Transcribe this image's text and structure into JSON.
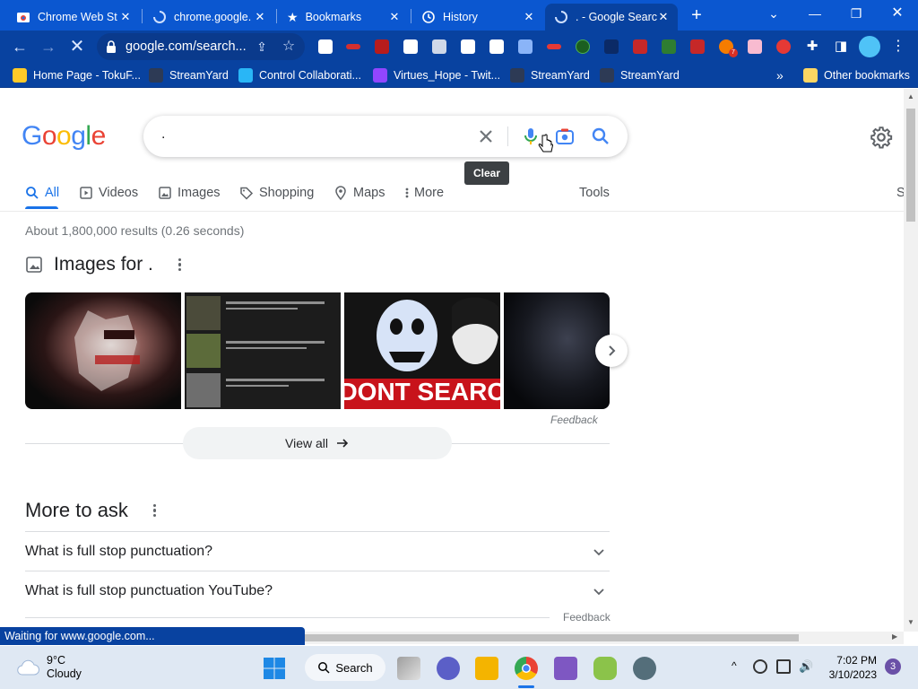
{
  "browser": {
    "tabs": [
      {
        "title": "Chrome Web St",
        "icon": "chrome-web-store-icon"
      },
      {
        "title": "chrome.google.",
        "icon": "loading-spinner-icon"
      },
      {
        "title": "Bookmarks",
        "icon": "star-icon"
      },
      {
        "title": "History",
        "icon": "history-icon"
      },
      {
        "title": ". - Google Searc",
        "icon": "loading-spinner-icon",
        "active": true
      }
    ],
    "omnibox_url": "google.com/search...",
    "status_text": "Waiting for www.google.com..."
  },
  "bookmarks": {
    "items": [
      {
        "label": "Home Page - TokuF..."
      },
      {
        "label": "StreamYard"
      },
      {
        "label": "Control Collaborati..."
      },
      {
        "label": "Virtues_Hope - Twit..."
      },
      {
        "label": "StreamYard"
      },
      {
        "label": "StreamYard"
      }
    ],
    "overflow": "»",
    "other": "Other bookmarks"
  },
  "google": {
    "logo": [
      "G",
      "o",
      "o",
      "g",
      "l",
      "e"
    ],
    "logo_colors": [
      "#4285F4",
      "#EA4335",
      "#FBBC05",
      "#4285F4",
      "#34A853",
      "#EA4335"
    ],
    "query": ".",
    "tooltip": "Clear",
    "tabs": [
      {
        "label": "All",
        "icon": "search-icon",
        "active": true
      },
      {
        "label": "Videos",
        "icon": "video-icon"
      },
      {
        "label": "Images",
        "icon": "image-icon"
      },
      {
        "label": "Shopping",
        "icon": "tag-icon"
      },
      {
        "label": "Maps",
        "icon": "map-pin-icon"
      },
      {
        "label": "More",
        "icon": "more-vert-icon"
      }
    ],
    "tools": "Tools",
    "cut_off_label": "S",
    "result_stats": "About 1,800,000 results (0.26 seconds)",
    "images_heading": "Images for .",
    "images_feedback": "Feedback",
    "view_all": "View all",
    "thumb_text": "DONT SEARC",
    "people_also_ask": {
      "heading": "More to ask",
      "questions": [
        "What is full stop punctuation?",
        "What is full stop punctuation YouTube?"
      ],
      "feedback": "Feedback"
    },
    "accent": "#1a73e8"
  },
  "taskbar": {
    "weather_temp": "9°C",
    "weather_desc": "Cloudy",
    "search_label": "Search",
    "time": "7:02 PM",
    "date": "3/10/2023",
    "notification_count": "3"
  }
}
